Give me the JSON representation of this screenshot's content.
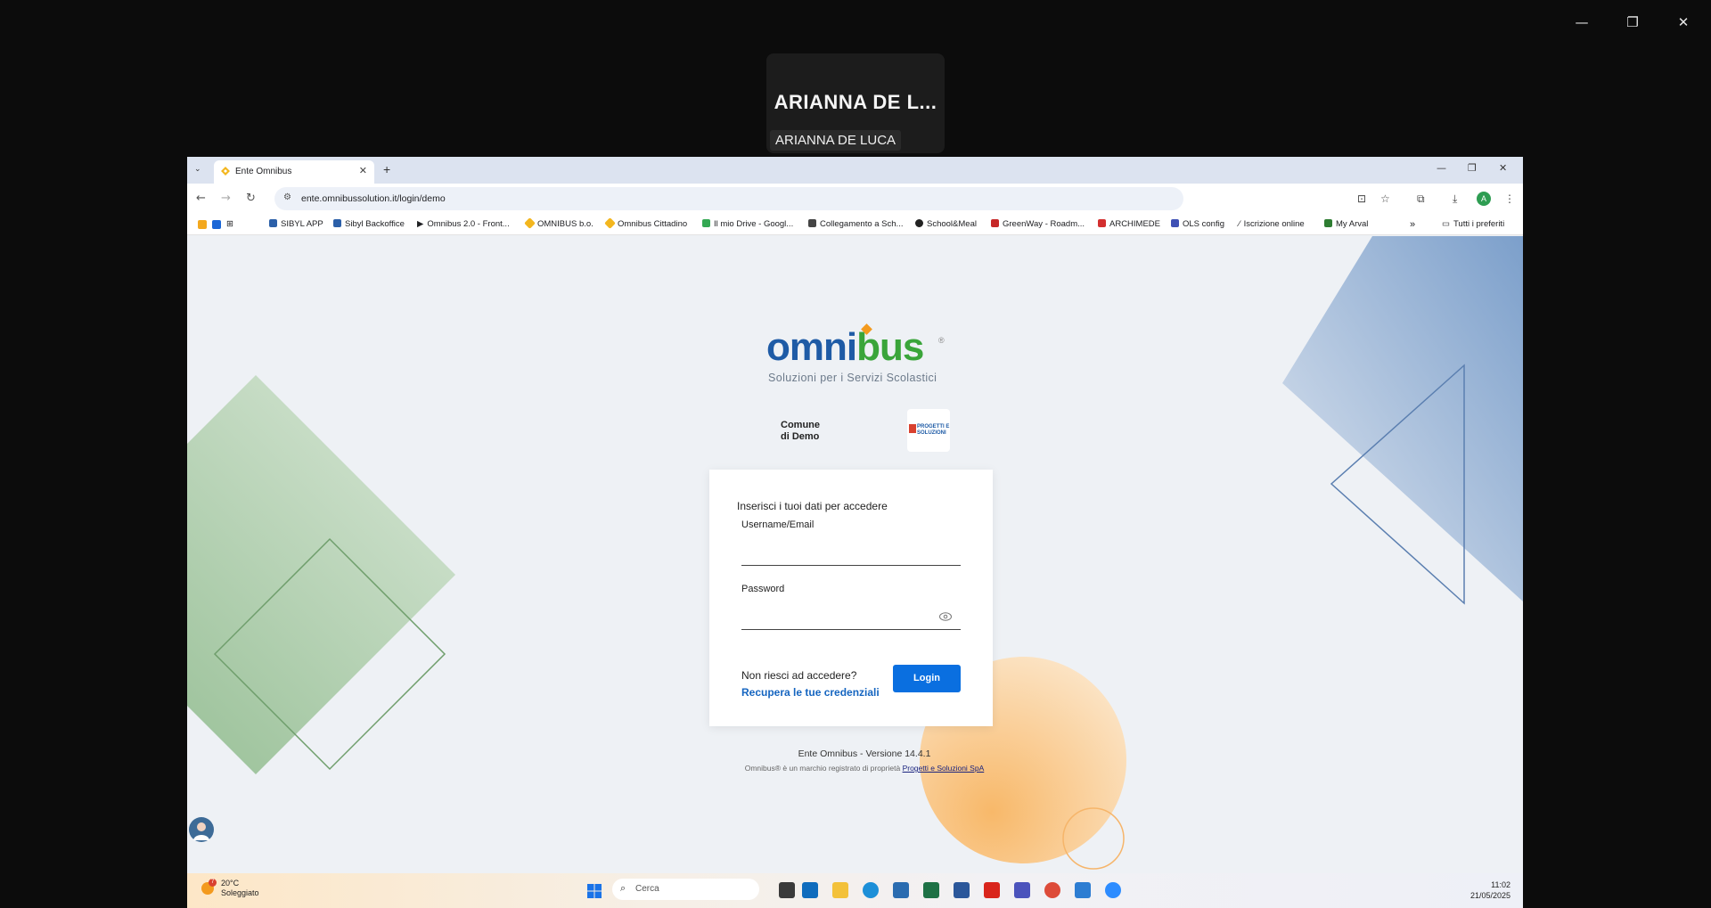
{
  "presenter": {
    "name_big": "ARIANNA DE L...",
    "name_tag": "ARIANNA DE LUCA"
  },
  "window_controls": {
    "minimize": "—",
    "restore": "❐",
    "close": "✕"
  },
  "browser": {
    "tab_title": "Ente Omnibus",
    "url": "ente.omnibussolution.it/login/demo",
    "avatar_letter": "A",
    "bookmarks": [
      "SIBYL APP",
      "Sibyl Backoffice",
      "Omnibus 2.0 - Front...",
      "OMNIBUS b.o.",
      "Omnibus Cittadino",
      "Il mio Drive - Googl...",
      "Collegamento a Sch...",
      "School&Meal",
      "GreenWay - Roadm...",
      "ARCHIMEDE",
      "OLS config",
      "Iscrizione online",
      "My Arval"
    ],
    "bookmarks_more": "»",
    "all_bookmarks": "Tutti i preferiti"
  },
  "page": {
    "logo_left": "omni",
    "logo_right": "bus",
    "logo_reg": "®",
    "logo_subtitle": "Soluzioni per i Servizi Scolastici",
    "comune_line1": "Comune",
    "comune_line2": "di Demo",
    "ps_logo_text": "PROGETTI E SOLUZIONI",
    "login_intro": "Inserisci i tuoi dati per accedere",
    "username_label": "Username/Email",
    "password_label": "Password",
    "trouble_text": "Non riesci ad accedere?",
    "recover_link": "Recupera le tue credenziali",
    "login_button": "Login",
    "version": "Ente Omnibus - Versione 14.4.1",
    "legal_text": "Omnibus® è un marchio registrato di proprietà",
    "legal_link": "Progetti e Soluzioni SpA"
  },
  "taskbar": {
    "weather_badge": "7",
    "temperature": "20°C",
    "condition": "Soleggiato",
    "search_placeholder": "Cerca",
    "time": "11:02",
    "date": "21/05/2025"
  },
  "colors": {
    "brand_blue": "#1e5ba6",
    "brand_green": "#3aa53a",
    "button_blue": "#0a6fe0",
    "link_blue": "#1565c0"
  }
}
